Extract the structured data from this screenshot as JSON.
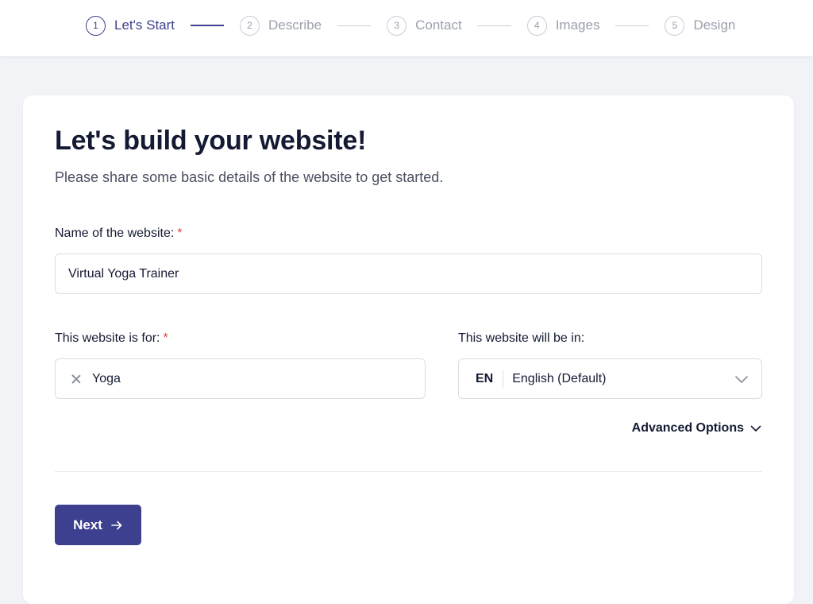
{
  "steps": [
    {
      "number": "1",
      "label": "Let's Start",
      "active": true
    },
    {
      "number": "2",
      "label": "Describe",
      "active": false
    },
    {
      "number": "3",
      "label": "Contact",
      "active": false
    },
    {
      "number": "4",
      "label": "Images",
      "active": false
    },
    {
      "number": "5",
      "label": "Design",
      "active": false
    }
  ],
  "form": {
    "title": "Let's build your website!",
    "subtitle": "Please share some basic details of the website to get started.",
    "name_label": "Name of the website:",
    "name_value": "Virtual Yoga Trainer",
    "for_label": "This website is for:",
    "for_value": "Yoga",
    "language_label": "This website will be in:",
    "language_code": "EN",
    "language_value": "English (Default)",
    "required_mark": "*",
    "advanced_options": "Advanced Options",
    "next_label": "Next"
  },
  "colors": {
    "accent": "#3d3f8f",
    "required": "#e0463b",
    "background": "#f1f3f7"
  }
}
